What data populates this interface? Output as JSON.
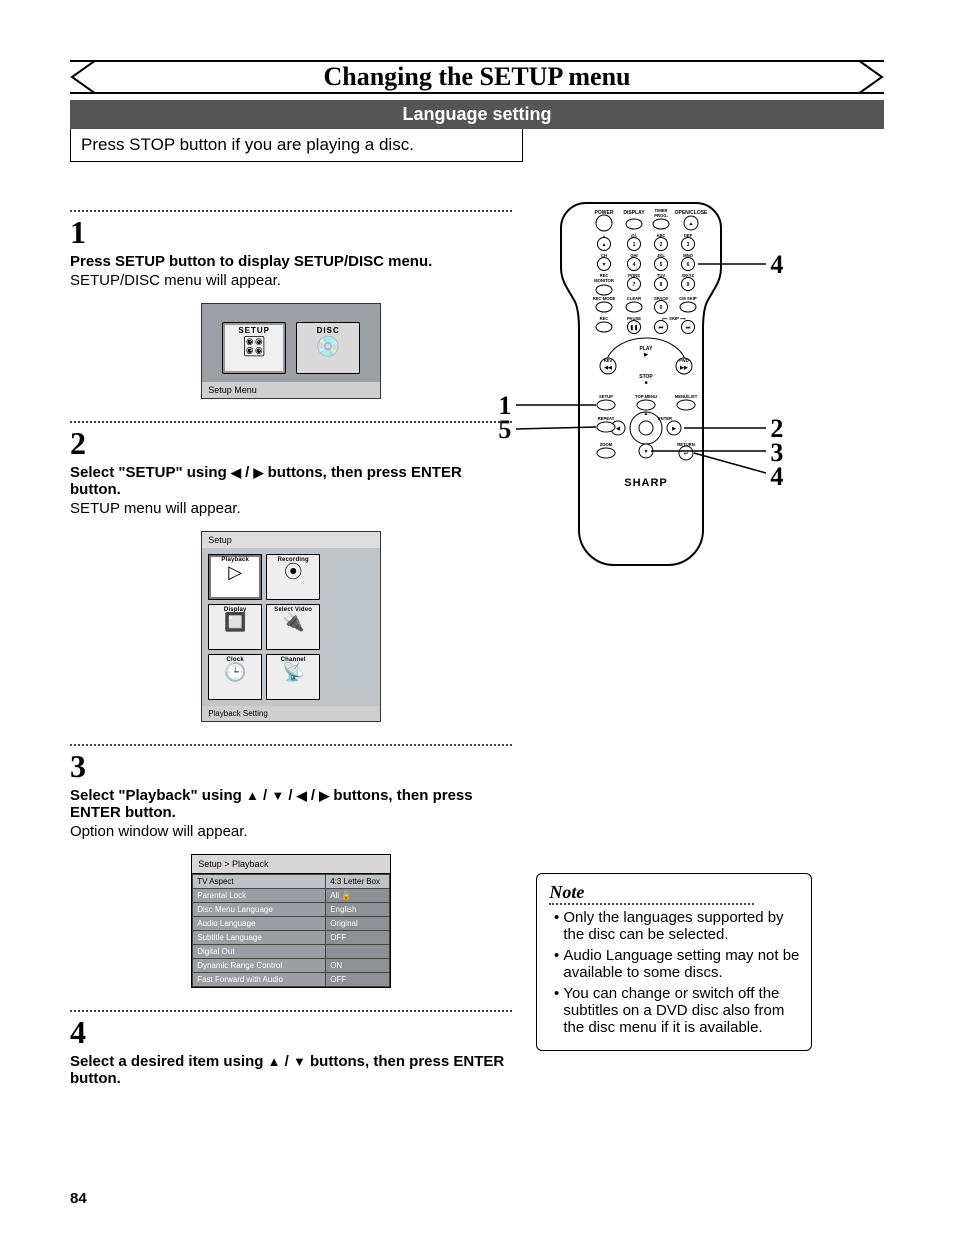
{
  "page_number": "84",
  "title": "Changing the SETUP menu",
  "subtitle": "Language setting",
  "callout": "Press STOP button if you are playing a disc.",
  "steps": {
    "s1": {
      "num": "1",
      "title": "Press SETUP button to display SETUP/DISC menu.",
      "sub": "SETUP/DISC menu will appear."
    },
    "s2": {
      "num": "2",
      "title_a": "Select \"SETUP\" using ",
      "title_b": " buttons, then press ENTER button.",
      "sub": "SETUP menu will appear."
    },
    "s3": {
      "num": "3",
      "title_a": "Select \"Playback\" using ",
      "title_b": " buttons, then press ENTER button.",
      "sub": "Option window will appear."
    },
    "s4": {
      "num": "4",
      "title_a": "Select a desired item using ",
      "title_b": " buttons, then press ENTER button."
    }
  },
  "fig1": {
    "caption": "Setup Menu",
    "tile_setup": "SETUP",
    "tile_disc": "DISC"
  },
  "fig2": {
    "topcap": "Setup",
    "tiles": [
      "Playback",
      "Recording",
      "Display",
      "Select Video",
      "Clock",
      "Channel"
    ],
    "caption": "Playback Setting"
  },
  "fig3": {
    "topcap": "Setup > Playback",
    "rows": [
      {
        "k": "TV Aspect",
        "v": "4:3 Letter Box"
      },
      {
        "k": "Parental Lock",
        "v": "All    🔒"
      },
      {
        "k": "Disc Menu Language",
        "v": "English"
      },
      {
        "k": "Audio Language",
        "v": "Original"
      },
      {
        "k": "Subtitle Language",
        "v": "OFF"
      },
      {
        "k": "Digital Out",
        "v": ""
      },
      {
        "k": "Dynamic Range Control",
        "v": "ON"
      },
      {
        "k": "Fast Forward with Audio",
        "v": "OFF"
      }
    ]
  },
  "remote": {
    "logo": "SHARP",
    "left_callouts": [
      "1",
      "5"
    ],
    "right_callouts_top": "4",
    "right_callouts_mid": [
      "2",
      "3",
      "4"
    ]
  },
  "note": {
    "title": "Note",
    "items": [
      "Only the languages supported by the disc can be selected.",
      "Audio Language setting may not be available to some discs.",
      "You can change or switch off the subtitles on a DVD disc also from the disc menu if it is available."
    ]
  }
}
